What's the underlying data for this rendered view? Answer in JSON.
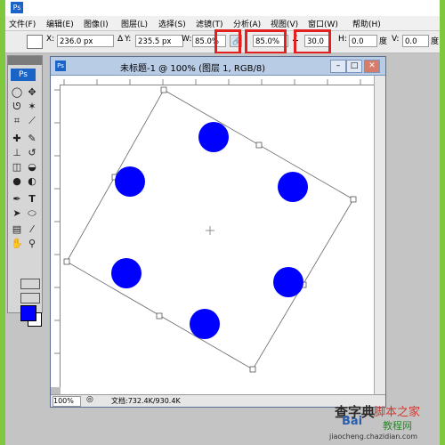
{
  "app": {
    "logo": "Ps"
  },
  "menu": [
    "文件(F)",
    "编辑(E)",
    "图像(I)",
    "图层(L)",
    "选择(S)",
    "滤镜(T)",
    "分析(A)",
    "视图(V)",
    "窗口(W)",
    "帮助(H)"
  ],
  "options": {
    "x_label": "X:",
    "x_value": "236.0 px",
    "y_label": "Y:",
    "y_value": "235.5 px",
    "w_label": "W:",
    "w_value": "85.0%",
    "h_value": "85.0%",
    "angle_value": "30.0",
    "hskew_label": "H:",
    "hskew_value": "0.0",
    "hskew_unit": "度",
    "vskew_label": "V:",
    "vskew_value": "0.0",
    "vskew_unit": "度"
  },
  "document": {
    "title": "未标题-1 @ 100% (图层 1, RGB/8)",
    "zoom": "100%",
    "doc_info": "文档:732.4K/930.4K"
  },
  "canvas": {
    "fill_color": "#0000ff",
    "rotation_deg": 30,
    "circle_count": 6
  },
  "watermark": {
    "left": "查字典",
    "brand": "脚本之家",
    "site_left": "Bai",
    "site_right": "教程网",
    "url": "jiaocheng.chazidian.com"
  },
  "colors": {
    "foreground": "#0000ff",
    "background": "#ffffff",
    "highlight": "#e32020"
  }
}
